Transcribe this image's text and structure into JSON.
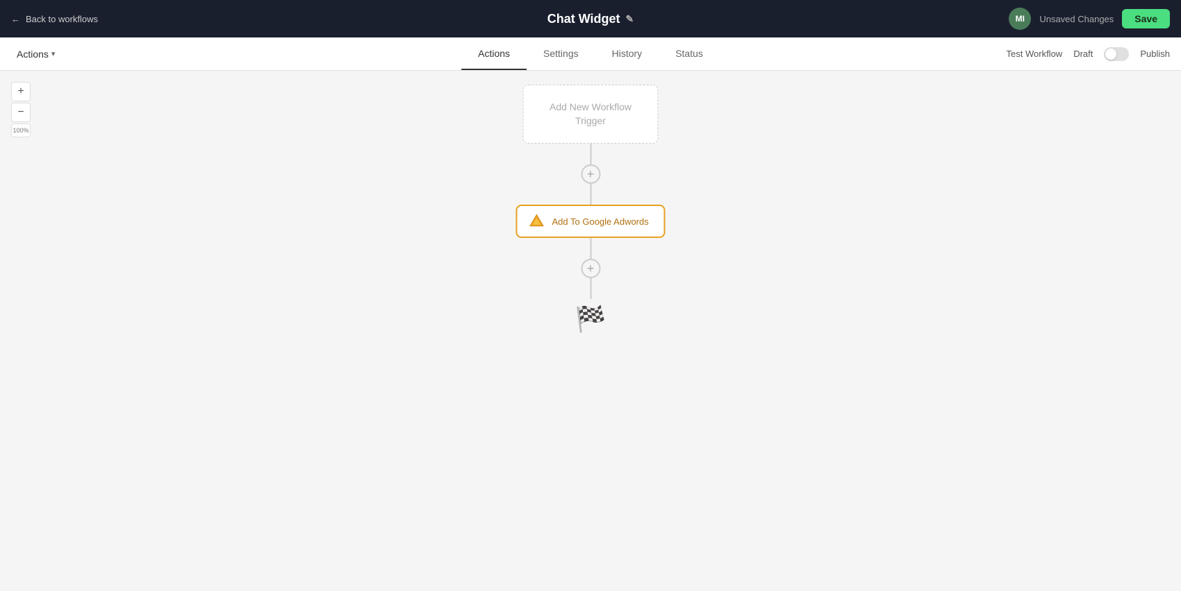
{
  "topbar": {
    "back_label": "Back to workflows",
    "title": "Chat Widget",
    "avatar_initials": "MI",
    "unsaved_label": "Unsaved Changes",
    "save_label": "Save"
  },
  "tabs_bar": {
    "actions_dropdown_label": "Actions",
    "tabs": [
      {
        "id": "actions",
        "label": "Actions",
        "active": true
      },
      {
        "id": "settings",
        "label": "Settings",
        "active": false
      },
      {
        "id": "history",
        "label": "History",
        "active": false
      },
      {
        "id": "status",
        "label": "Status",
        "active": false
      }
    ],
    "test_workflow_label": "Test Workflow",
    "draft_label": "Draft",
    "publish_label": "Publish"
  },
  "canvas": {
    "zoom_in_label": "+",
    "zoom_out_label": "−",
    "zoom_percent": "100%",
    "trigger_node": {
      "line1": "Add New Workflow",
      "line2": "Trigger"
    },
    "action_node": {
      "label": "Add To Google Adwords"
    },
    "finish_icon": "🏁"
  }
}
